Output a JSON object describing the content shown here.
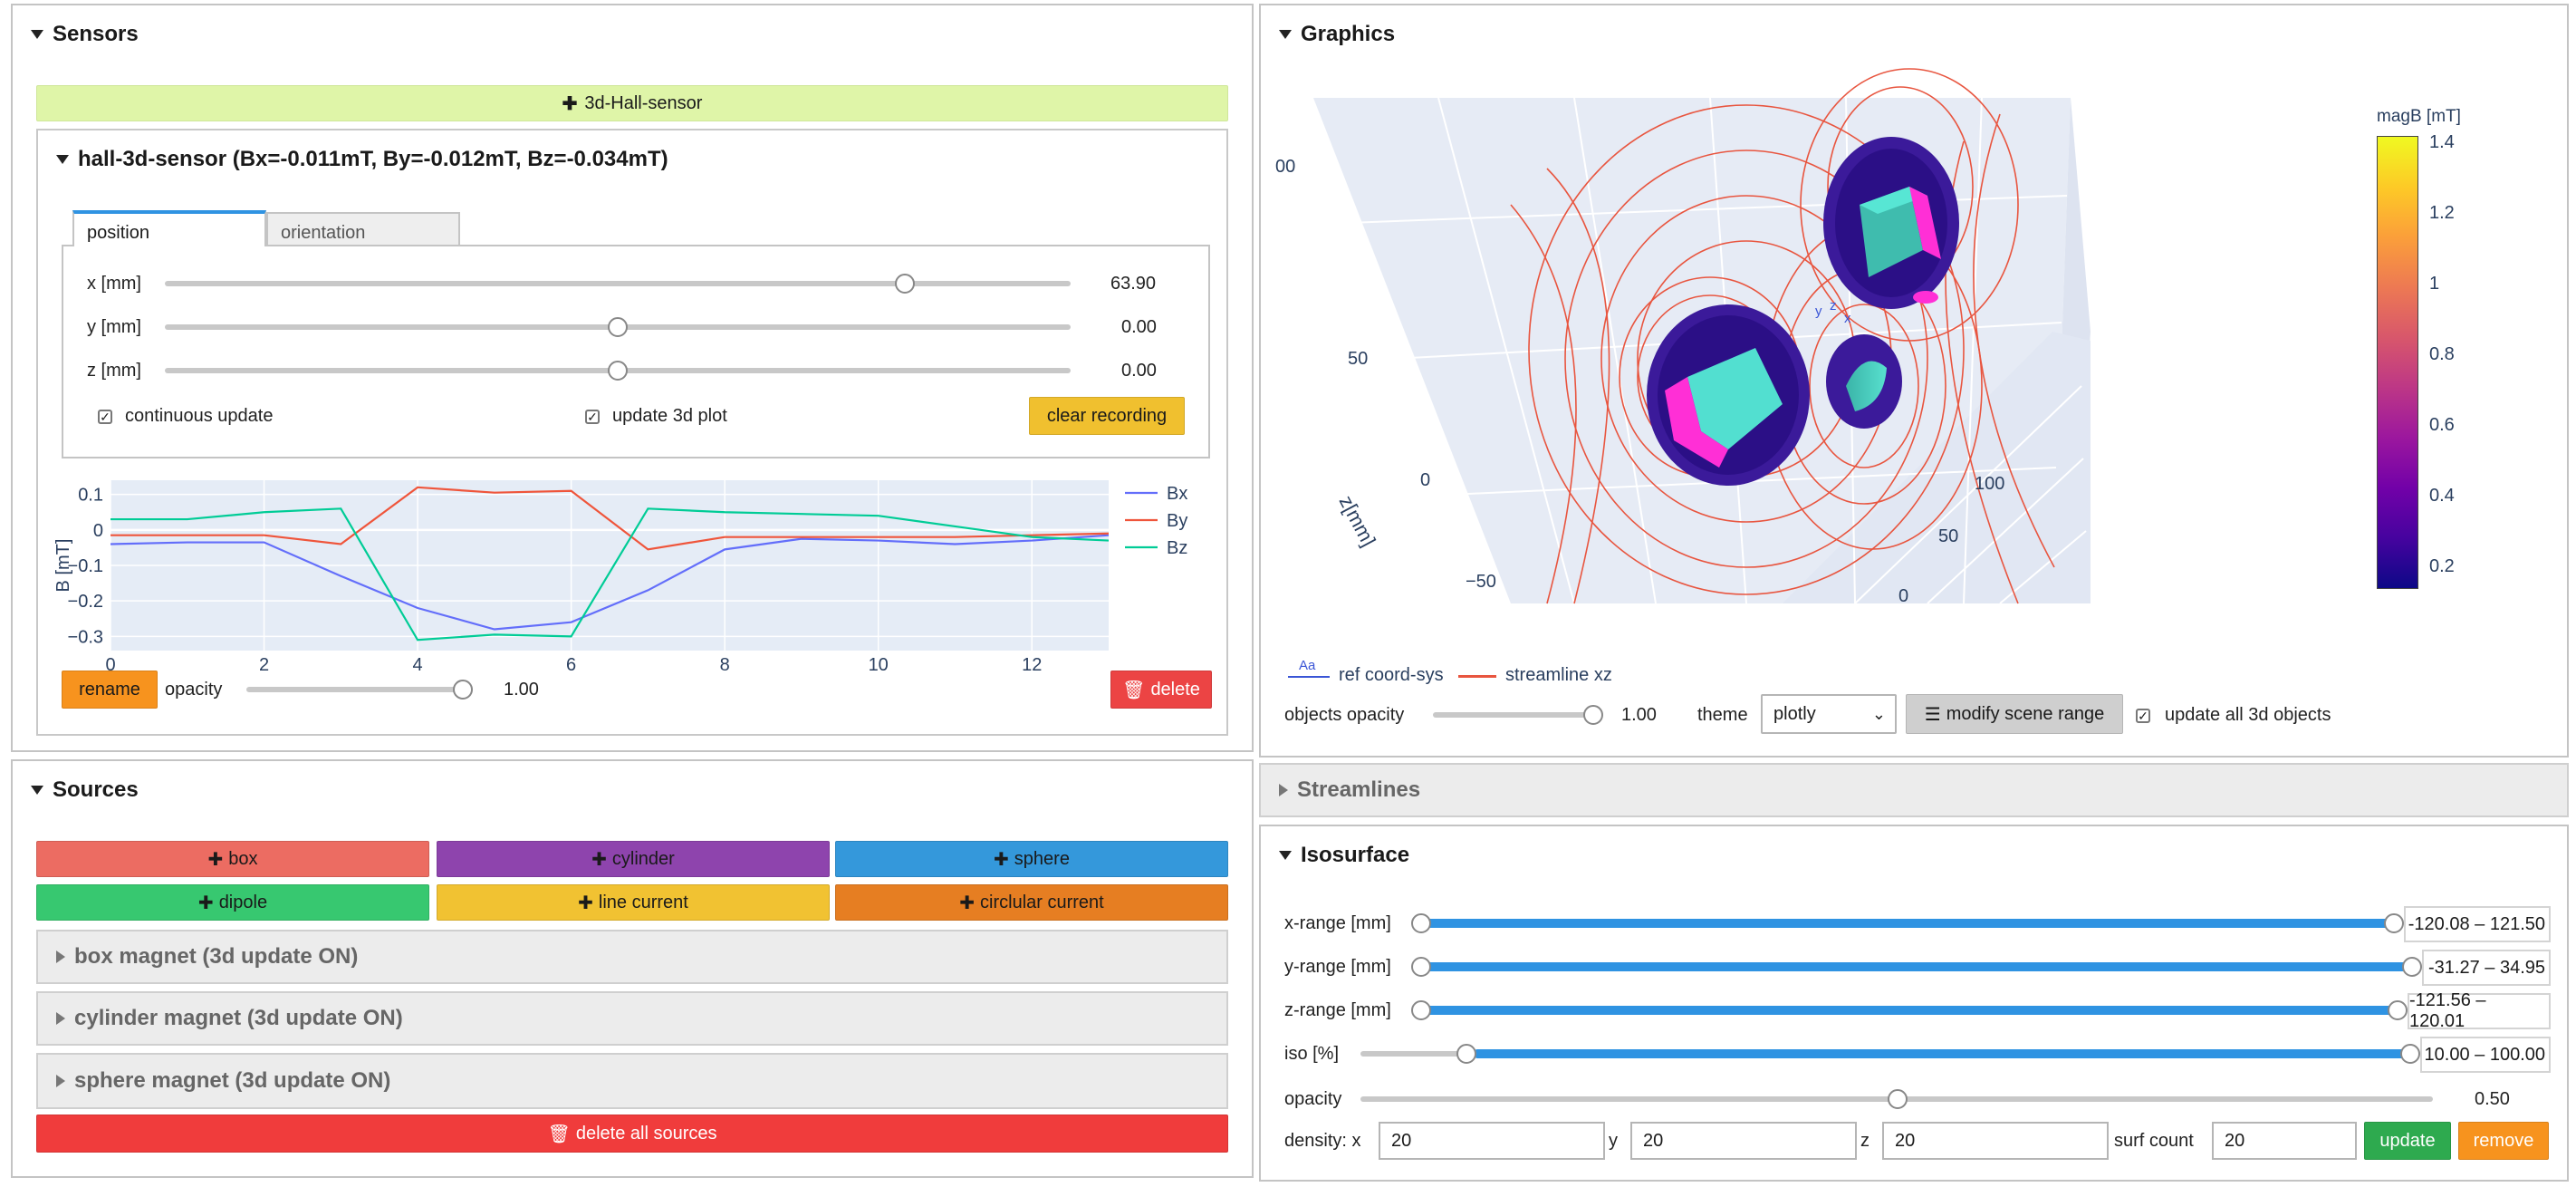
{
  "sensors": {
    "title": "Sensors",
    "add_label": "3d-Hall-sensor",
    "sensor_title": "hall-3d-sensor (Bx=-0.011mT, By=-0.012mT, Bz=-0.034mT)",
    "tabs": [
      "position",
      "orientation"
    ],
    "sliders": [
      {
        "label": "x [mm]",
        "value": "63.90",
        "fraction": 0.82
      },
      {
        "label": "y [mm]",
        "value": "0.00",
        "fraction": 0.5
      },
      {
        "label": "z [mm]",
        "value": "0.00",
        "fraction": 0.5
      }
    ],
    "continuous_update": "continuous update",
    "update_3d_plot": "update 3d plot",
    "clear_recording": "clear recording",
    "rename": "rename",
    "opacity_label": "opacity",
    "opacity_value": "1.00",
    "delete": "delete"
  },
  "chart_data": {
    "type": "line",
    "ylabel": "B [mT]",
    "xlim": [
      0,
      13
    ],
    "ylim": [
      -0.34,
      0.14
    ],
    "x_ticks": [
      "0",
      "2",
      "4",
      "6",
      "8",
      "10",
      "12"
    ],
    "y_ticks": [
      "0.1",
      "0",
      "−0.1",
      "−0.2",
      "−0.3"
    ],
    "legend_position": "right",
    "series": [
      {
        "name": "Bx",
        "color": "#636efa",
        "x": [
          0,
          1,
          2,
          3,
          4,
          5,
          6,
          7,
          8,
          9,
          10,
          11,
          12,
          13
        ],
        "y": [
          -0.04,
          -0.035,
          -0.035,
          -0.13,
          -0.22,
          -0.28,
          -0.26,
          -0.17,
          -0.055,
          -0.025,
          -0.03,
          -0.04,
          -0.03,
          -0.015
        ]
      },
      {
        "name": "By",
        "color": "#ef553b",
        "x": [
          0,
          1,
          2,
          3,
          4,
          5,
          6,
          7,
          8,
          9,
          10,
          11,
          12,
          13
        ],
        "y": [
          -0.015,
          -0.015,
          -0.015,
          -0.04,
          0.12,
          0.105,
          0.11,
          -0.055,
          -0.02,
          -0.02,
          -0.02,
          -0.02,
          -0.015,
          -0.01
        ]
      },
      {
        "name": "Bz",
        "color": "#00cc96",
        "x": [
          0,
          1,
          2,
          3,
          4,
          5,
          6,
          7,
          8,
          9,
          10,
          11,
          12,
          13
        ],
        "y": [
          0.03,
          0.03,
          0.05,
          0.06,
          -0.31,
          -0.295,
          -0.3,
          0.06,
          0.05,
          0.045,
          0.04,
          0.01,
          -0.02,
          -0.03
        ]
      }
    ]
  },
  "sources": {
    "title": "Sources",
    "add_buttons": [
      {
        "label": "box",
        "color": "#ec6c62"
      },
      {
        "label": "cylinder",
        "color": "#8e44ad"
      },
      {
        "label": "sphere",
        "color": "#3498db"
      },
      {
        "label": "dipole",
        "color": "#37c870"
      },
      {
        "label": "line current",
        "color": "#f1c232"
      },
      {
        "label": "circlular current",
        "color": "#e67e22"
      }
    ],
    "magnets": [
      "box magnet (3d update ON)",
      "cylinder magnet (3d update ON)",
      "sphere magnet (3d update ON)"
    ],
    "delete_all": "delete all sources"
  },
  "graphics": {
    "title": "Graphics",
    "axis_labels": {
      "z": "z[mm]",
      "z_ticks": [
        "50",
        "0",
        "−50"
      ],
      "y_ticks": [
        "100",
        "50",
        "0"
      ],
      "top_partial": "00"
    },
    "colorbar": {
      "title": "magB [mT]",
      "ticks": [
        "1.4",
        "1.2",
        "1",
        "0.8",
        "0.6",
        "0.4",
        "0.2"
      ]
    },
    "legend": [
      {
        "name": "ref coord-sys",
        "symbol": "Aa",
        "color": "#3a55d6"
      },
      {
        "name": "streamline xz",
        "color": "#e8553f"
      }
    ],
    "objects_opacity_label": "objects opacity",
    "objects_opacity_value": "1.00",
    "theme_label": "theme",
    "theme_value": "plotly",
    "modify_scene_range": "modify scene range",
    "update_all": "update all 3d objects"
  },
  "streamlines": {
    "title": "Streamlines"
  },
  "isosurface": {
    "title": "Isosurface",
    "ranges": [
      {
        "label": "x-range [mm]",
        "value": "-120.08 – 121.50"
      },
      {
        "label": "y-range [mm]",
        "value": "-31.27 – 34.95"
      },
      {
        "label": "z-range [mm]",
        "value": "-121.56 – 120.01"
      },
      {
        "label": "iso [%]",
        "value": "10.00 – 100.00"
      }
    ],
    "opacity_label": "opacity",
    "opacity_value": "0.50",
    "density_label": "density: x",
    "y_label": "y",
    "z_label": "z",
    "surf_count_label": "surf count",
    "density_x": "20",
    "density_y": "20",
    "density_z": "20",
    "surf_count": "20",
    "update": "update",
    "remove": "remove"
  }
}
